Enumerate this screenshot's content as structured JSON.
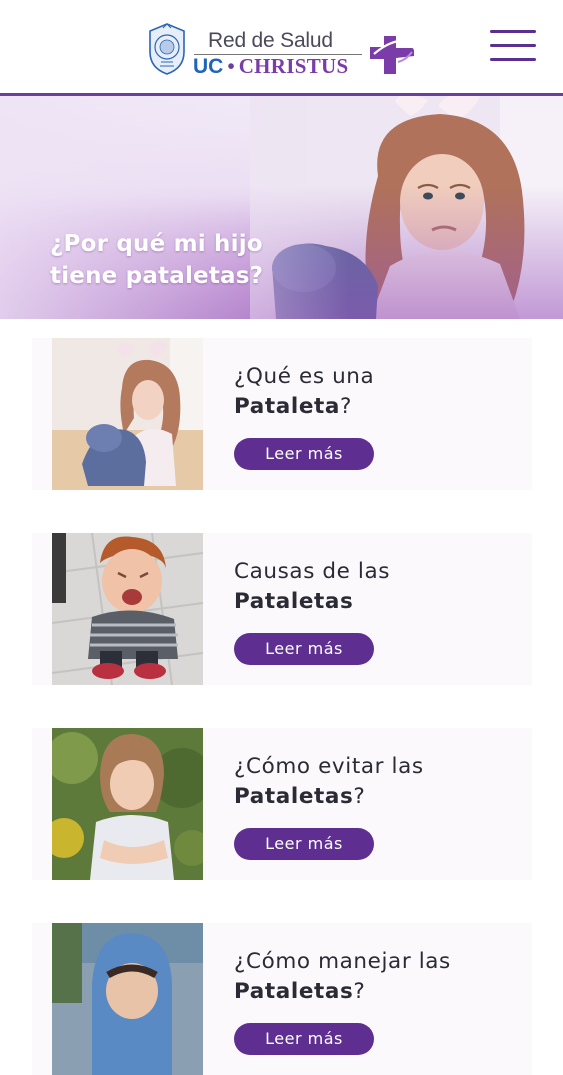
{
  "header": {
    "logo": {
      "line1": "Red de Salud",
      "uc": "UC",
      "dot": "•",
      "christus": "CHRISTUS"
    },
    "menu_icon": "hamburger-icon",
    "accent": "#5e2f91"
  },
  "hero": {
    "title_line1": "¿Por qué mi hijo",
    "title_line2": "tiene pataletas?"
  },
  "cards": [
    {
      "line1": "¿Qué es una",
      "bold": "Pataleta",
      "suffix": "?",
      "button": "Leer más"
    },
    {
      "line1": "Causas de las",
      "bold": "Pataletas",
      "suffix": "",
      "button": "Leer más"
    },
    {
      "line1": "¿Cómo evitar las",
      "bold": "Pataletas",
      "suffix": "?",
      "button": "Leer más"
    },
    {
      "line1": "¿Cómo manejar las",
      "bold": "Pataletas",
      "suffix": "?",
      "button": "Leer más"
    }
  ]
}
